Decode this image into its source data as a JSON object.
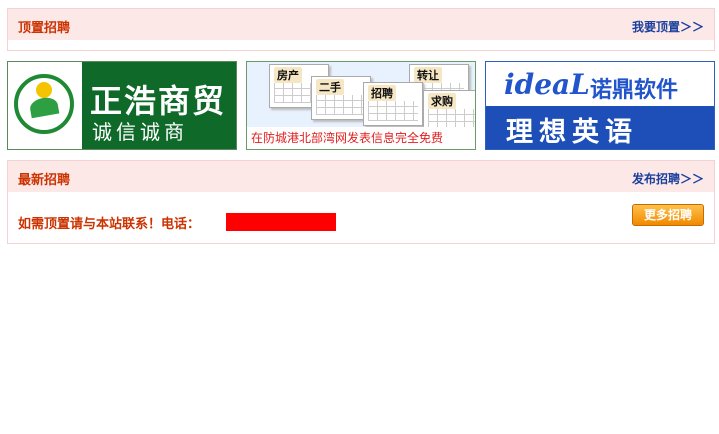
{
  "top_panel": {
    "title": "顶置招聘",
    "link": "我要顶置＞＞"
  },
  "ads": [
    {
      "line1": "正浩商贸",
      "line2": "诚信诚商"
    },
    {
      "tags": [
        "房产",
        "二手",
        "招聘",
        "转让",
        "求购"
      ],
      "caption": "在防城港北部湾网发表信息完全免费"
    },
    {
      "brand": "ideaL",
      "brand_cn": "诺鼎软件",
      "line2": "理想英语"
    }
  ],
  "latest_panel": {
    "title": "最新招聘",
    "link": "发布招聘＞＞",
    "contact_text": "如需顶置请与本站联系！电话：",
    "more_button": "更多招聘"
  },
  "colors": {
    "title_red": "#cc3300",
    "link_blue": "#1a3f9c",
    "header_bg": "#fde8e8",
    "phone_box": "#ff0000",
    "button_orange": "#f08a00"
  }
}
